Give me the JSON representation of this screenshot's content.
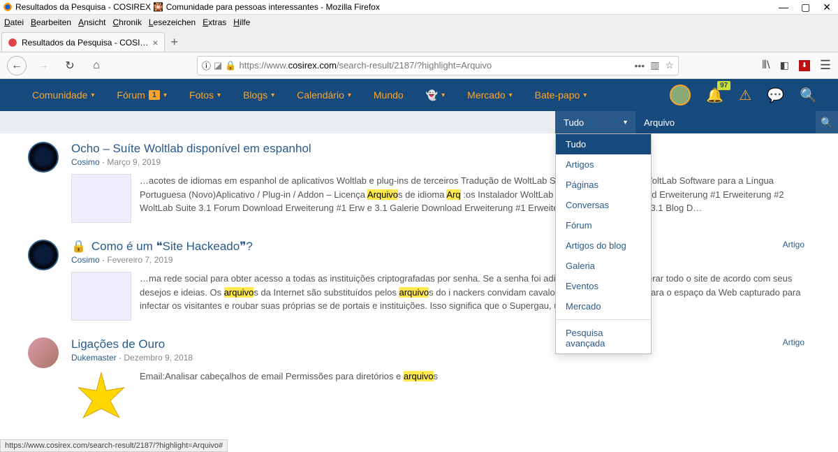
{
  "window": {
    "title": "Resultados da Pesquisa - COSIREX 🎇 Comunidade para pessoas interessantes - Mozilla Firefox"
  },
  "menu": {
    "file": "Datei",
    "edit": "Bearbeiten",
    "view": "Ansicht",
    "history": "Chronik",
    "bookmarks": "Lesezeichen",
    "extras": "Extras",
    "help": "Hilfe"
  },
  "tab": {
    "title": "Resultados da Pesquisa - COSI…"
  },
  "url": {
    "prefix": "https://www.",
    "domain": "cosirex.com",
    "path": "/search-result/2187/?highlight=Arquivo"
  },
  "nav": {
    "comunidade": "Comunidade",
    "forum": "Fórum",
    "forum_badge": "1",
    "fotos": "Fotos",
    "blogs": "Blogs",
    "calendario": "Calendário",
    "mundo": "Mundo",
    "mercado": "Mercado",
    "batepapo": "Bate-papo",
    "notif_count": "97"
  },
  "search": {
    "type_selected": "Tudo",
    "value": "Arquivo"
  },
  "dropdown": {
    "items": [
      "Tudo",
      "Artigos",
      "Páginas",
      "Conversas",
      "Fórum",
      "Artigos do blog",
      "Galeria",
      "Eventos",
      "Mercado"
    ],
    "advanced": "Pesquisa avançada"
  },
  "results": [
    {
      "title": "Ocho – Suíte Woltlab disponível em espanhol",
      "author": "Cosimo",
      "date": "Março 9, 2019",
      "excerpt_parts": [
        {
          "t": "…acotes de idiomas em espanhol de aplicativos Woltlab e plug-ins de terceiros Tradução de WoltLab So                                       anholaTradução de WoltLab Software para a Língua Portuguesa (Novo)Aplicativo / Plug-in / Addon – Licença "
        },
        {
          "t": "Arquivo",
          "hl": true
        },
        {
          "t": "s de idioma "
        },
        {
          "t": "Arq",
          "hl": true
        },
        {
          "t": "                :os Instalador WoltLab Suite 3.1 Core Download Erweiterung #1 Erweiterung #2 WoltLab Suite 3.1 Forum Download Erweiterung #1 Erw                     e 3.1 Galerie Download Erweiterung #1 Erweiterung #2 WoltLab Suite 3.1 Blog D…"
        }
      ]
    },
    {
      "title": "Como é um ❝Site Hackeado❞?",
      "author": "Cosimo",
      "date": "Fevereiro 7, 2019",
      "tag": "Artigo",
      "locked": true,
      "excerpt_parts": [
        {
          "t": "…ma rede social para obter acesso a todas as instituições criptografadas por senha. Se a senha foi adiv                      eb, o hacker pode alterar todo o site de acordo com seus desejos e ideias. Os "
        },
        {
          "t": "arquivo",
          "hl": true
        },
        {
          "t": "s da Internet são substituídos pelos "
        },
        {
          "t": "arquivo",
          "hl": true
        },
        {
          "t": "s do i                    nackers convidam cavalos de Tróia escondidos para o espaço da Web capturado para infectar os visitantes e roubar suas próprias se                        de portais e instituições. Isso significa que o Supergau, um t…"
        }
      ]
    },
    {
      "title": "Ligações de Ouro",
      "author": "Dukemaster",
      "date": "Dezembro 9, 2018",
      "tag": "Artigo",
      "excerpt_parts": [
        {
          "t": "Email:Analisar cabeçalhos de email Permissões para diretórios e "
        },
        {
          "t": "arquivo",
          "hl": true
        },
        {
          "t": "s"
        }
      ]
    }
  ],
  "statusbar": "https://www.cosirex.com/search-result/2187/?highlight=Arquivo#"
}
